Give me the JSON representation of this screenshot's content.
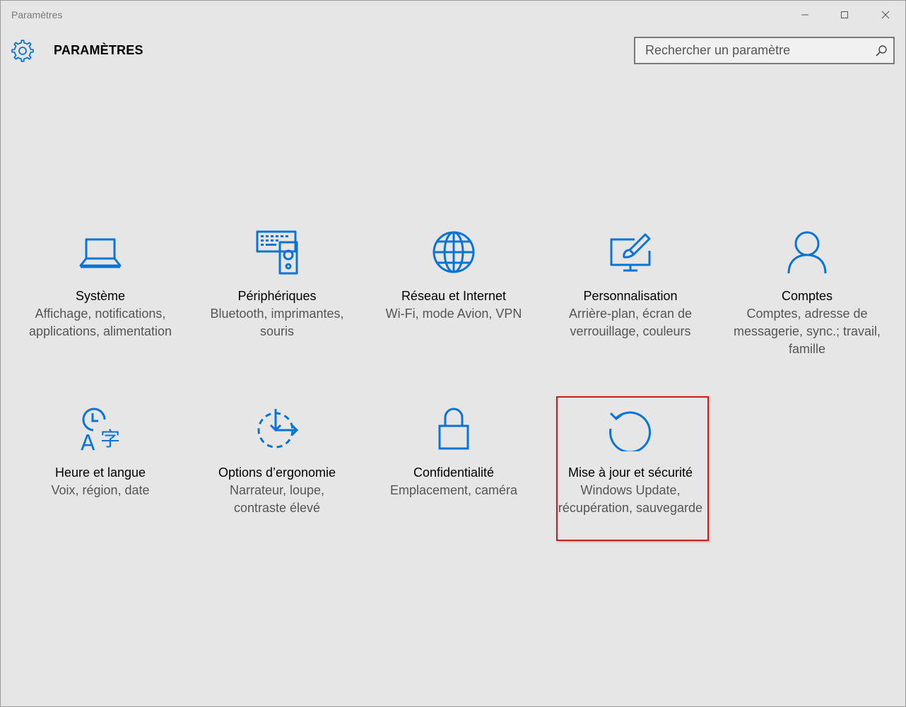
{
  "window": {
    "title": "Paramètres"
  },
  "header": {
    "title": "PARAMÈTRES",
    "icon": "gear-icon"
  },
  "search": {
    "placeholder": "Rechercher un paramètre",
    "value": ""
  },
  "colors": {
    "accent": "#0a74d6",
    "background": "#e6e6e6",
    "highlight": "#d11a1a"
  },
  "tiles": [
    {
      "icon": "laptop-icon",
      "title": "Système",
      "desc": "Affichage, notifications, applications, alimentation"
    },
    {
      "icon": "keyboard-speaker-icon",
      "title": "Périphériques",
      "desc": "Bluetooth, imprimantes, souris"
    },
    {
      "icon": "globe-icon",
      "title": "Réseau et Internet",
      "desc": "Wi-Fi, mode Avion, VPN"
    },
    {
      "icon": "paint-monitor-icon",
      "title": "Personnalisation",
      "desc": "Arrière-plan, écran de verrouillage, couleurs"
    },
    {
      "icon": "person-icon",
      "title": "Comptes",
      "desc": "Comptes, adresse de messagerie, sync.; travail, famille"
    },
    {
      "icon": "time-language-icon",
      "title": "Heure et langue",
      "desc": "Voix, région, date"
    },
    {
      "icon": "ease-of-access-icon",
      "title": "Options d’ergonomie",
      "desc": "Narrateur, loupe, contraste élevé"
    },
    {
      "icon": "lock-icon",
      "title": "Confidentialité",
      "desc": "Emplacement, caméra"
    },
    {
      "icon": "refresh-icon",
      "title": "Mise à jour et sécurité",
      "desc": "Windows Update, récupération, sauvegarde"
    }
  ]
}
